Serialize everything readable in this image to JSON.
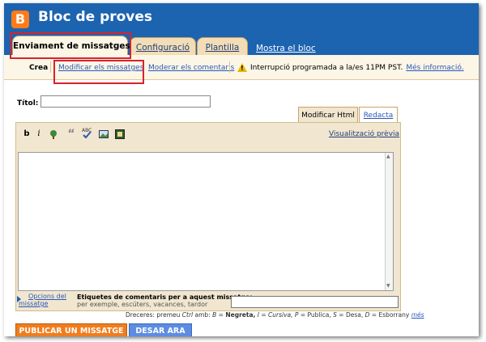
{
  "header": {
    "blog_title": "Bloc de proves",
    "logo_letter": "B",
    "tabs": [
      {
        "label": "Enviament de missatges"
      },
      {
        "label": "Configuració"
      },
      {
        "label": "Plantilla"
      }
    ],
    "view_blog": "Mostra el  bloc"
  },
  "subnav": {
    "items": [
      {
        "label": "Crea"
      },
      {
        "label": "Modificar els missatges"
      },
      {
        "label": "Moderar els comentaris"
      }
    ],
    "notice": "Interrupció programada a la/es 11PM PST.",
    "notice_link": "Més informació."
  },
  "post": {
    "title_label": "Títol:",
    "title_value": ""
  },
  "editor": {
    "modes": [
      {
        "label": "Modificar Html"
      },
      {
        "label": "Redacta"
      }
    ],
    "toolbar": {
      "bold": "b",
      "italic": "i",
      "quote": "“",
      "spellcheck": "ABC",
      "preview": "Visualització prèvia"
    },
    "body": ""
  },
  "post_options": {
    "link": "Opcions del missatge",
    "labels_title": "Etiquetes de comentaris per a aquest missatge:",
    "labels_hint": "per exemple, escúters, vacances, tardor",
    "labels_value": ""
  },
  "shortcuts": {
    "prefix": "Dreceres: premeu",
    "ctrl": "Ctrl",
    "amb": "amb:",
    "b_key": "B",
    "b_label": "Negreta,",
    "i_key": "I",
    "i_label": "Cursiva,",
    "p_key": "P",
    "p_label": "Publica,",
    "s_key": "S",
    "s_label": "Desa,",
    "d_key": "D",
    "d_label": "Esborrany",
    "more": "més",
    "eq": "="
  },
  "actions": {
    "publish": "PUBLICAR UN MISSATGE",
    "save": "DESAR ARA"
  },
  "colors": {
    "header_blue": "#1c63b0",
    "tab_beige": "#f2ddb6",
    "highlight_red": "#d8222d",
    "publish_orange": "#f07d1d",
    "save_blue": "#5d8de2"
  }
}
